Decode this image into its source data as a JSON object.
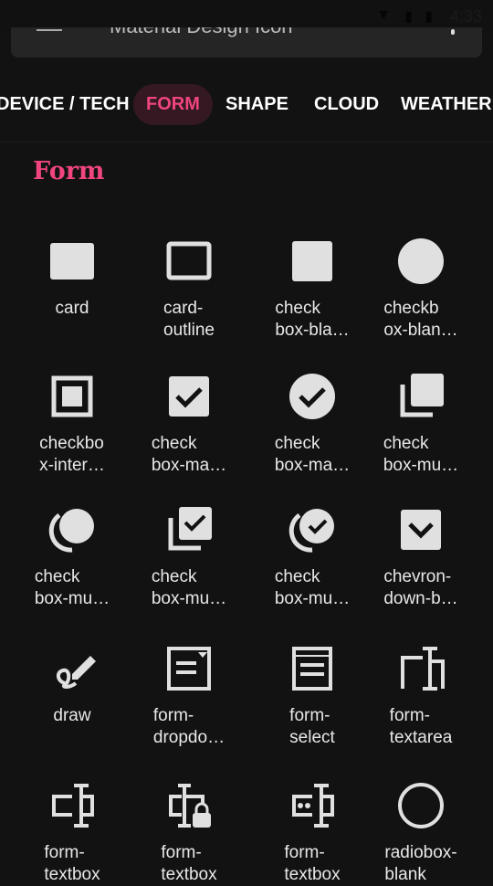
{
  "status": {
    "time": "4:33"
  },
  "search": {
    "text": "Material Design Icon"
  },
  "tabs": [
    {
      "label": "DEVICE / TECH"
    },
    {
      "label": "FORM",
      "active": true
    },
    {
      "label": "SHAPE"
    },
    {
      "label": "CLOUD"
    },
    {
      "label": "WEATHER"
    }
  ],
  "section_title": "Form",
  "accent": "#f0457e",
  "icons": [
    {
      "icon": "card",
      "label": "card"
    },
    {
      "icon": "card-outline",
      "label": "card-\noutline"
    },
    {
      "icon": "checkbox-blank",
      "label": "check\nbox-bla…"
    },
    {
      "icon": "checkbox-blank-circle",
      "label": "checkb\nox-blan…"
    },
    {
      "icon": "checkbox-intermediate",
      "label": "checkbo\nx-inter…"
    },
    {
      "icon": "checkbox-marked",
      "label": "check\nbox-ma…"
    },
    {
      "icon": "checkbox-marked-circle",
      "label": "check\nbox-ma…"
    },
    {
      "icon": "checkbox-multiple-blank",
      "label": "check\nbox-mu…"
    },
    {
      "icon": "checkbox-multiple-blank-circle",
      "label": "check\nbox-mu…"
    },
    {
      "icon": "checkbox-multiple-marked",
      "label": "check\nbox-mu…"
    },
    {
      "icon": "checkbox-multiple-marked-circle",
      "label": "check\nbox-mu…"
    },
    {
      "icon": "chevron-down-box",
      "label": "chevron-\ndown-b…"
    },
    {
      "icon": "draw",
      "label": "draw"
    },
    {
      "icon": "form-dropdown",
      "label": "form-\ndropdo…"
    },
    {
      "icon": "form-select",
      "label": "form-\nselect"
    },
    {
      "icon": "form-textarea",
      "label": "form-\ntextarea"
    },
    {
      "icon": "form-textbox",
      "label": "form-\ntextbox"
    },
    {
      "icon": "form-textbox-lock",
      "label": "form-\ntextbox"
    },
    {
      "icon": "form-textbox-password",
      "label": "form-\ntextbox"
    },
    {
      "icon": "radiobox-blank",
      "label": "radiobox-\nblank"
    }
  ]
}
